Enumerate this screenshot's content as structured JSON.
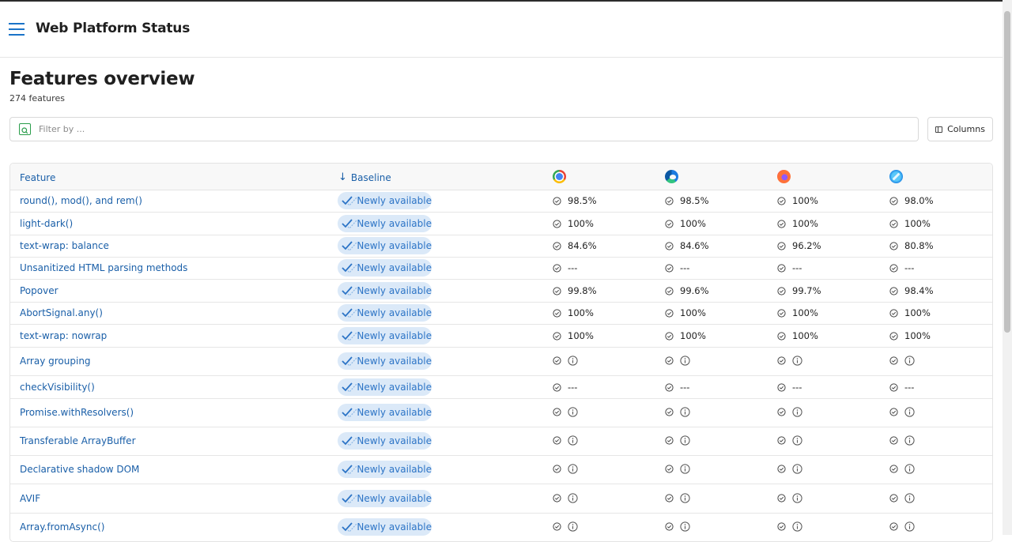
{
  "app": {
    "title": "Web Platform Status"
  },
  "page": {
    "title": "Features overview",
    "count": "274 features"
  },
  "filter": {
    "placeholder": "Filter by ..."
  },
  "columns_button": {
    "label": "Columns"
  },
  "table": {
    "headers": {
      "feature": "Feature",
      "baseline": "Baseline",
      "sort_icon": "arrow-down-icon"
    },
    "browsers": [
      "chrome-logo-icon",
      "edge-logo-icon",
      "firefox-logo-icon",
      "safari-logo-icon"
    ],
    "colors": {
      "link": "#1a5fa8",
      "badge_bg": "#dbe9f8",
      "badge_text": "#2c74c6"
    },
    "rows": [
      {
        "name": "round(), mod(), and rem()",
        "baseline": "Newly available",
        "support": [
          "98.5%",
          "98.5%",
          "100%",
          "98.0%"
        ],
        "info": false
      },
      {
        "name": "light-dark()",
        "baseline": "Newly available",
        "support": [
          "100%",
          "100%",
          "100%",
          "100%"
        ],
        "info": false
      },
      {
        "name": "text-wrap: balance",
        "baseline": "Newly available",
        "support": [
          "84.6%",
          "84.6%",
          "96.2%",
          "80.8%"
        ],
        "info": false
      },
      {
        "name": "Unsanitized HTML parsing methods",
        "baseline": "Newly available",
        "support": [
          "---",
          "---",
          "---",
          "---"
        ],
        "info": false
      },
      {
        "name": "Popover",
        "baseline": "Newly available",
        "support": [
          "99.8%",
          "99.6%",
          "99.7%",
          "98.4%"
        ],
        "info": false
      },
      {
        "name": "AbortSignal.any()",
        "baseline": "Newly available",
        "support": [
          "100%",
          "100%",
          "100%",
          "100%"
        ],
        "info": false
      },
      {
        "name": "text-wrap: nowrap",
        "baseline": "Newly available",
        "support": [
          "100%",
          "100%",
          "100%",
          "100%"
        ],
        "info": false
      },
      {
        "name": "Array grouping",
        "baseline": "Newly available",
        "support": [
          "",
          "",
          "",
          ""
        ],
        "info": true
      },
      {
        "name": "checkVisibility()",
        "baseline": "Newly available",
        "support": [
          "---",
          "---",
          "---",
          "---"
        ],
        "info": false
      },
      {
        "name": "Promise.withResolvers()",
        "baseline": "Newly available",
        "support": [
          "",
          "",
          "",
          ""
        ],
        "info": true
      },
      {
        "name": "Transferable ArrayBuffer",
        "baseline": "Newly available",
        "support": [
          "",
          "",
          "",
          ""
        ],
        "info": true
      },
      {
        "name": "Declarative shadow DOM",
        "baseline": "Newly available",
        "support": [
          "",
          "",
          "",
          ""
        ],
        "info": true
      },
      {
        "name": "AVIF",
        "baseline": "Newly available",
        "support": [
          "",
          "",
          "",
          ""
        ],
        "info": true
      },
      {
        "name": "Array.fromAsync()",
        "baseline": "Newly available",
        "support": [
          "",
          "",
          "",
          ""
        ],
        "info": true
      }
    ]
  }
}
